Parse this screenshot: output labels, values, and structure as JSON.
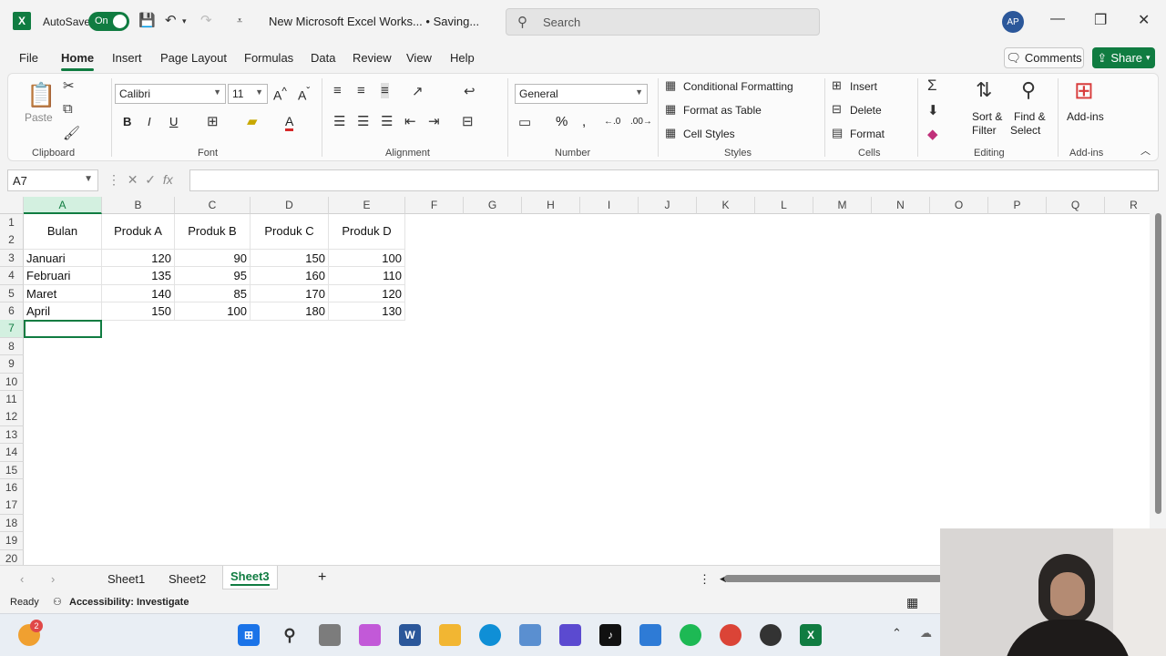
{
  "titlebar": {
    "autosave_label": "AutoSave",
    "autosave_state": "On",
    "doc_title": "New Microsoft Excel Works... • Saving...",
    "search_placeholder": "Search",
    "avatar_initials": "AP"
  },
  "menu": {
    "items": [
      "File",
      "Home",
      "Insert",
      "Page Layout",
      "Formulas",
      "Data",
      "Review",
      "View",
      "Help"
    ],
    "active": "Home",
    "comments_label": "Comments",
    "share_label": "Share"
  },
  "ribbon": {
    "groups": [
      "Clipboard",
      "Font",
      "Alignment",
      "Number",
      "Styles",
      "Cells",
      "Editing",
      "Add-ins"
    ],
    "paste_label": "Paste",
    "font_name": "Calibri",
    "font_size": "11",
    "number_format": "General",
    "styles": [
      "Conditional Formatting",
      "Format as Table",
      "Cell Styles"
    ],
    "cells": [
      "Insert",
      "Delete",
      "Format"
    ],
    "sort_filter": [
      "Sort &",
      "Filter"
    ],
    "find_select": [
      "Find &",
      "Select"
    ],
    "addins_label": "Add-ins"
  },
  "formula_bar": {
    "name_box": "A7",
    "fx_label": "fx",
    "formula": ""
  },
  "sheet": {
    "columns": [
      "A",
      "B",
      "C",
      "D",
      "E",
      "F",
      "G",
      "H",
      "I",
      "J",
      "K",
      "L",
      "M",
      "N",
      "O",
      "P",
      "Q",
      "R"
    ],
    "rows": [
      "1",
      "2",
      "3",
      "4",
      "5",
      "6",
      "7",
      "8",
      "9",
      "10",
      "11",
      "12",
      "13",
      "14",
      "15",
      "16",
      "17",
      "18",
      "19",
      "20"
    ],
    "headers": [
      "Bulan",
      "Produk A",
      "Produk B",
      "Produk C",
      "Produk D"
    ],
    "data": [
      [
        "Januari",
        "120",
        "90",
        "150",
        "100"
      ],
      [
        "Februari",
        "135",
        "95",
        "160",
        "110"
      ],
      [
        "Maret",
        "140",
        "85",
        "170",
        "120"
      ],
      [
        "April",
        "150",
        "100",
        "180",
        "130"
      ]
    ],
    "selected_cell": "A7"
  },
  "sheet_tabs": {
    "tabs": [
      "Sheet1",
      "Sheet2",
      "Sheet3"
    ],
    "active": "Sheet3"
  },
  "status": {
    "ready": "Ready",
    "accessibility": "Accessibility: Investigate"
  },
  "taskbar": {
    "widget_badge": "2"
  },
  "colors": {
    "excel_green": "#107c41",
    "accent_blue": "#2b579a"
  }
}
